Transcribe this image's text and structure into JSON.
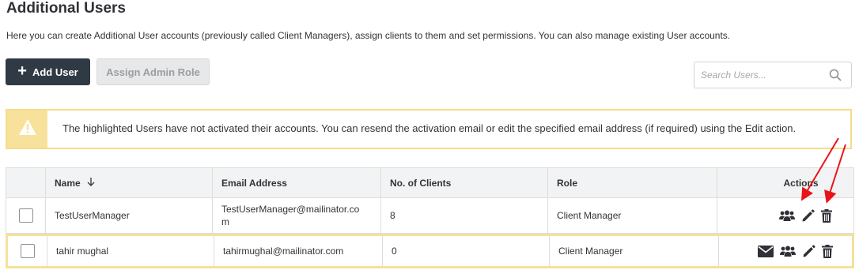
{
  "page": {
    "title": "Additional Users",
    "description": "Here you can create Additional User accounts (previously called Client Managers), assign clients to them and set permissions. You can also manage existing User accounts."
  },
  "toolbar": {
    "add_user_label": "Add User",
    "assign_admin_label": "Assign Admin Role",
    "search_placeholder": "Search Users..."
  },
  "alert": {
    "message": "The highlighted Users have not activated their accounts. You can resend the activation email or edit the specified email address (if required) using the Edit action.",
    "colors": {
      "border": "#f5dc8a",
      "icon_bg": "#f8e29b"
    }
  },
  "table": {
    "columns": [
      "Name",
      "Email Address",
      "No. of Clients",
      "Role",
      "Actions"
    ],
    "rows": [
      {
        "name": "TestUserManager",
        "email_line1": "TestUserManager@mailinator.co",
        "email_line2": "m",
        "clients": "8",
        "role": "Client Manager",
        "actions": [
          "users-icon",
          "edit-icon",
          "delete-icon"
        ]
      },
      {
        "name": "tahir mughal",
        "email": "tahirmughal@mailinator.com",
        "clients": "0",
        "role": "Client Manager",
        "highlighted": true,
        "actions": [
          "mail-icon",
          "users-icon",
          "edit-icon",
          "delete-icon"
        ]
      }
    ]
  },
  "colors": {
    "primary_button": "#2f3a45",
    "annotation_arrow": "#e8141a",
    "highlight_row_border": "#f6e09b"
  }
}
